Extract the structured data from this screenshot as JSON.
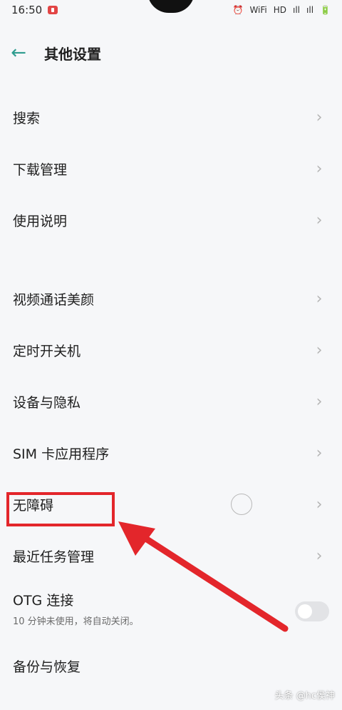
{
  "status": {
    "time": "16:50",
    "indicators": [
      "⏰",
      "WiFi",
      "HD",
      "ıll",
      "ıll",
      "🔋"
    ]
  },
  "header": {
    "back_icon": "arrow-left-icon",
    "title": "其他设置"
  },
  "items": [
    {
      "label": "搜索"
    },
    {
      "label": "下载管理"
    },
    {
      "label": "使用说明"
    },
    {
      "label": "视频通话美颜"
    },
    {
      "label": "定时开关机"
    },
    {
      "label": "设备与隐私"
    },
    {
      "label": "SIM 卡应用程序"
    },
    {
      "label": "无障碍"
    },
    {
      "label": "最近任务管理"
    }
  ],
  "otg": {
    "label": "OTG 连接",
    "subtitle": "10 分钟未使用，将自动关闭。",
    "enabled": false
  },
  "partial_item": {
    "label": "备份与恢复"
  },
  "watermark": "头条 @hc侯神",
  "colors": {
    "accent": "#2e9c8f",
    "highlight": "#e3262b",
    "chevron": "#b5b5b5"
  }
}
